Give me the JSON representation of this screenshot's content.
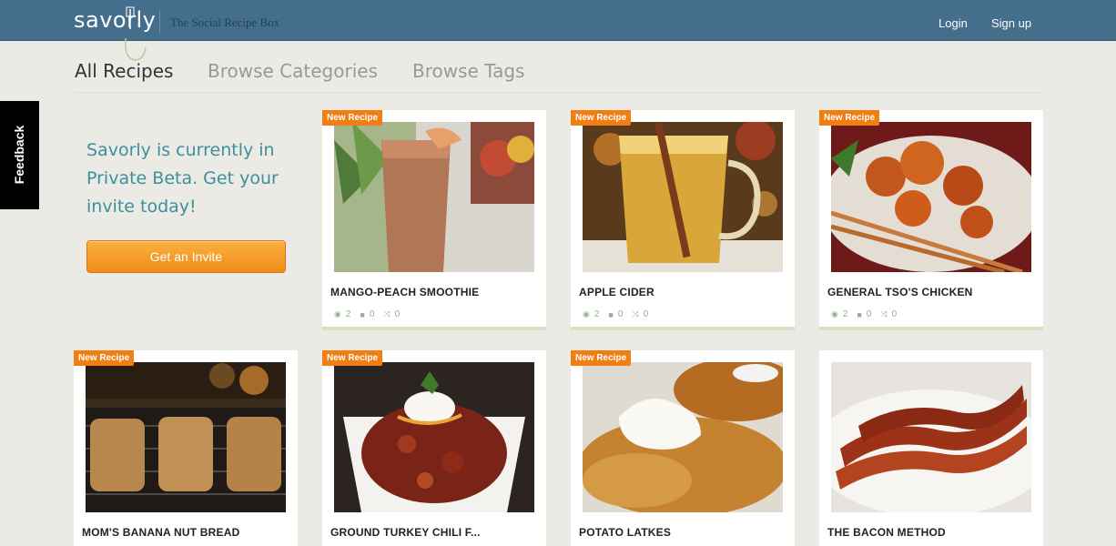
{
  "header": {
    "logo_text": "savorly",
    "tagline": "The Social Recipe Box",
    "login": "Login",
    "signup": "Sign up"
  },
  "tabs": [
    "All Recipes",
    "Browse Categories",
    "Browse Tags"
  ],
  "feedback": "Feedback",
  "promo": {
    "text": "Savorly is currently in Private Beta. Get your invite today!",
    "button": "Get an Invite"
  },
  "badge": "New Recipe",
  "recipes": [
    {
      "title": "MANGO-PEACH SMOOTHIE",
      "views": "2",
      "comments": "0",
      "shares": "0",
      "new": true
    },
    {
      "title": "APPLE CIDER",
      "views": "2",
      "comments": "0",
      "shares": "0",
      "new": true
    },
    {
      "title": "GENERAL TSO'S CHICKEN",
      "views": "2",
      "comments": "0",
      "shares": "0",
      "new": true
    },
    {
      "title": "MOM'S BANANA NUT BREAD",
      "new": true
    },
    {
      "title": "GROUND TURKEY CHILI F...",
      "new": true
    },
    {
      "title": "POTATO LATKES",
      "new": true
    },
    {
      "title": "THE BACON METHOD",
      "new": false
    }
  ],
  "colors": {
    "header": "#436f8c",
    "accent_orange": "#f07e12",
    "promo_text": "#3d8f9c",
    "stat_green": "#93b28f"
  }
}
